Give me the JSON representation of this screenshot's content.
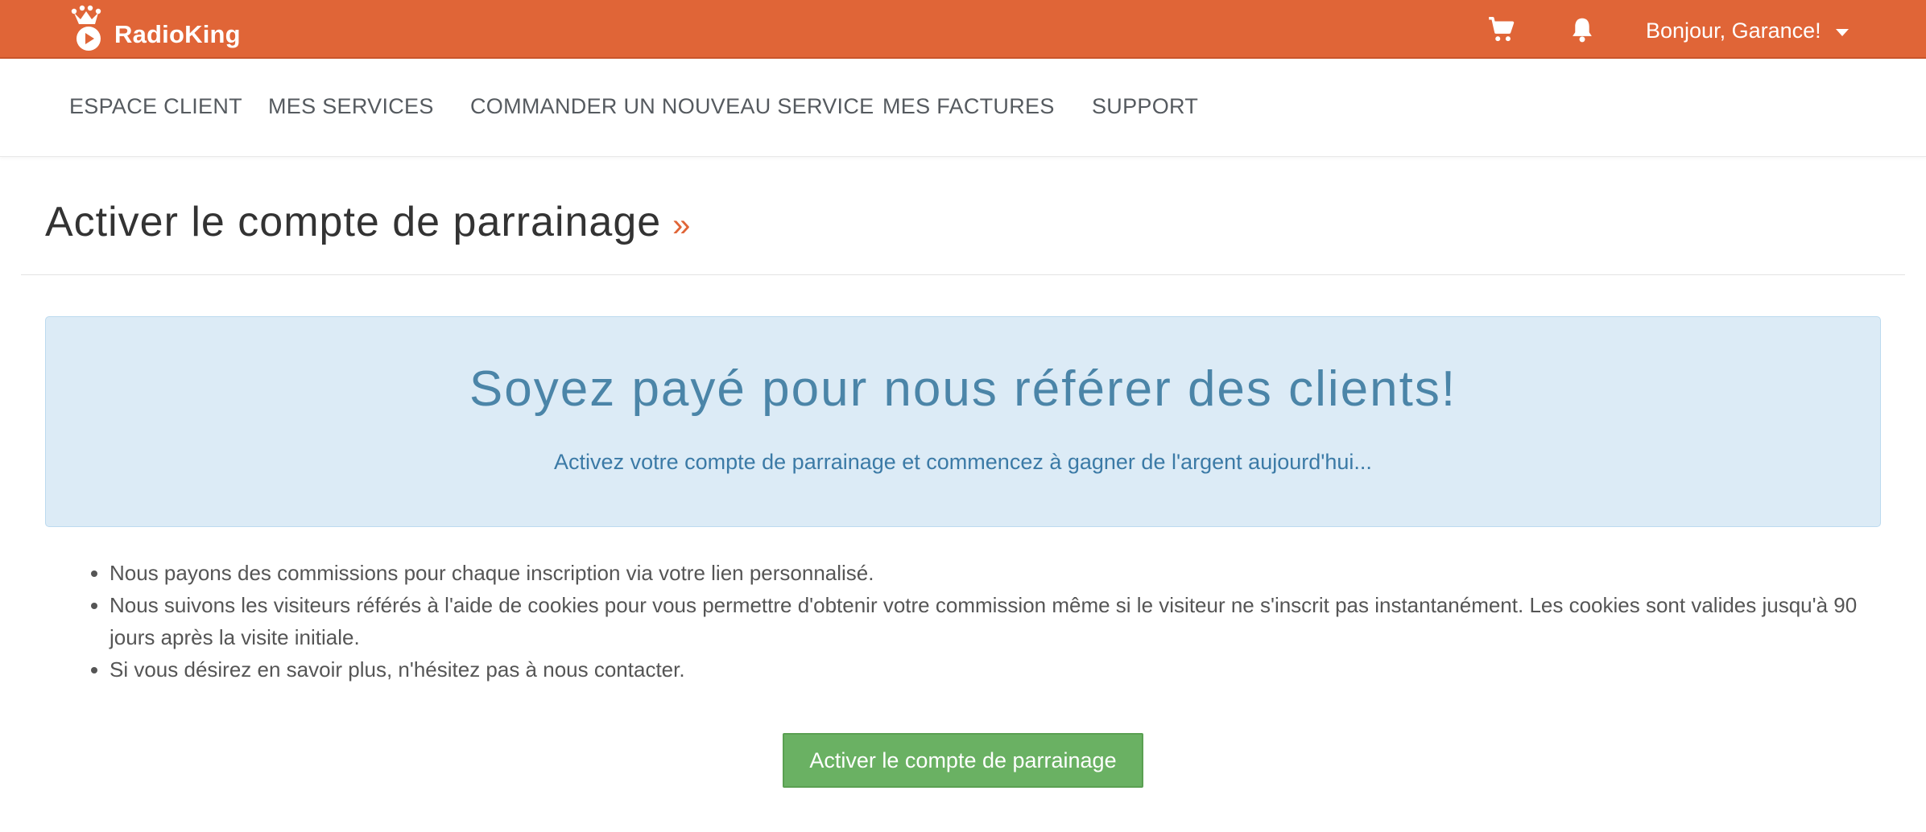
{
  "brand": {
    "name": "RadioKing"
  },
  "colors": {
    "brand_orange": "#e06537",
    "promo_bg": "#dcebf6",
    "accent_text": "#3b7aa6",
    "button_green": "#6ab163"
  },
  "topbar": {
    "icons": [
      "cart-icon",
      "bell-icon"
    ],
    "user_greeting": "Bonjour, Garance!"
  },
  "nav": {
    "items": [
      {
        "label": "ESPACE CLIENT"
      },
      {
        "label": "MES SERVICES"
      },
      {
        "label": "COMMANDER UN NOUVEAU SERVICE"
      },
      {
        "label": "MES FACTURES"
      },
      {
        "label": "SUPPORT"
      }
    ]
  },
  "page": {
    "title": "Activer le compte de parrainage",
    "title_suffix": "»"
  },
  "promo": {
    "heading": "Soyez payé pour nous référer des clients!",
    "subtext": "Activez votre compte de parrainage et commencez à gagner de l'argent aujourd'hui..."
  },
  "benefits": [
    "Nous payons des commissions pour chaque inscription via votre lien personnalisé.",
    "Nous suivons les visiteurs référés à l'aide de cookies pour vous permettre d'obtenir votre commission même si le visiteur ne s'inscrit pas instantanément. Les cookies sont valides jusqu'à 90 jours après la visite initiale.",
    "Si vous désirez en savoir plus, n'hésitez pas à nous contacter."
  ],
  "actions": {
    "activate_label": "Activer le compte de parrainage"
  }
}
